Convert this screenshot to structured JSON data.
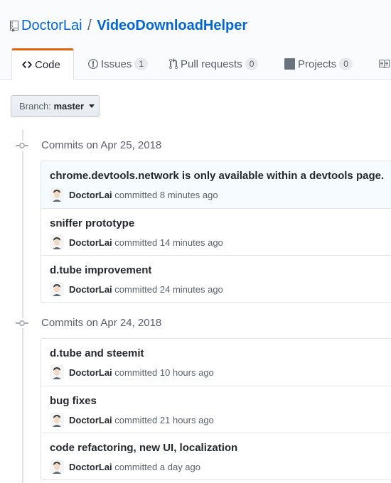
{
  "repo": {
    "owner": "DoctorLai",
    "separator": "/",
    "name": "VideoDownloadHelper"
  },
  "tabs": [
    {
      "label": "Code"
    },
    {
      "label": "Issues",
      "count": "1"
    },
    {
      "label": "Pull requests",
      "count": "0"
    },
    {
      "label": "Projects",
      "count": "0"
    }
  ],
  "branch": {
    "prefix": "Branch:",
    "value": "master"
  },
  "groups": [
    {
      "title": "Commits on Apr 25, 2018",
      "commits": [
        {
          "message": "chrome.devtools.network is only available within a devtools page.",
          "author": "DoctorLai",
          "verb": "committed",
          "time": "8 minutes ago"
        },
        {
          "message": "sniffer prototype",
          "author": "DoctorLai",
          "verb": "committed",
          "time": "14 minutes ago"
        },
        {
          "message": "d.tube improvement",
          "author": "DoctorLai",
          "verb": "committed",
          "time": "24 minutes ago"
        }
      ]
    },
    {
      "title": "Commits on Apr 24, 2018",
      "commits": [
        {
          "message": "d.tube and steemit",
          "author": "DoctorLai",
          "verb": "committed",
          "time": "10 hours ago"
        },
        {
          "message": "bug fixes",
          "author": "DoctorLai",
          "verb": "committed",
          "time": "21 hours ago"
        },
        {
          "message": "code refactoring, new UI, localization",
          "author": "DoctorLai",
          "verb": "committed",
          "time": "a day ago"
        }
      ]
    }
  ],
  "colors": {
    "link": "#0366d6",
    "tab_accent": "#e36209",
    "highlight_row": "#f6fbff"
  }
}
